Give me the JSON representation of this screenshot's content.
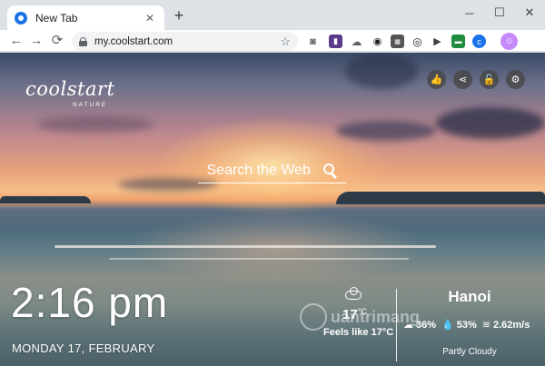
{
  "browser": {
    "tab": {
      "title": "New Tab"
    },
    "new_tab_label": "+",
    "window_controls": {
      "minimize": "─",
      "maximize": "☐",
      "close": "✕"
    },
    "nav": {
      "back": "←",
      "forward": "→",
      "reload": "⟳"
    },
    "address_bar": {
      "url": "my.coolstart.com"
    },
    "icons": {
      "favicon": "coolstart-favicon",
      "lock": "lock-icon",
      "bookmark": "star-icon",
      "extensions": [
        "camera-icon",
        "phone-icon",
        "cloud-download-icon",
        "camera-alt-icon",
        "ruler-icon",
        "eye-icon",
        "play-icon",
        "gallery-icon",
        "coolstart-ext-icon",
        "profile-avatar"
      ]
    }
  },
  "page": {
    "logo": {
      "main": "coolstart",
      "sub": "NATURE"
    },
    "actions": [
      {
        "name": "like",
        "glyph": "👍"
      },
      {
        "name": "share",
        "glyph": "⋖"
      },
      {
        "name": "lock",
        "glyph": "🔓"
      },
      {
        "name": "settings",
        "glyph": "⚙"
      }
    ],
    "search": {
      "placeholder": "Search the Web"
    },
    "clock": {
      "time": "2:16 pm",
      "date": "MONDAY 17, FEBRUARY"
    },
    "weather": {
      "temperature": "17",
      "temperature_unit": "°C",
      "feels_like": "Feels like 17°C",
      "city": "Hanoi",
      "cloud_cover": "36%",
      "humidity": "53%",
      "wind": "2.62m/s",
      "condition": "Partly Cloudy",
      "icons": {
        "main": "cloud-icon",
        "clouds": "cloud-small-icon",
        "humidity": "drop-icon",
        "wind": "wind-icon"
      }
    },
    "watermark": "uantrimang"
  }
}
